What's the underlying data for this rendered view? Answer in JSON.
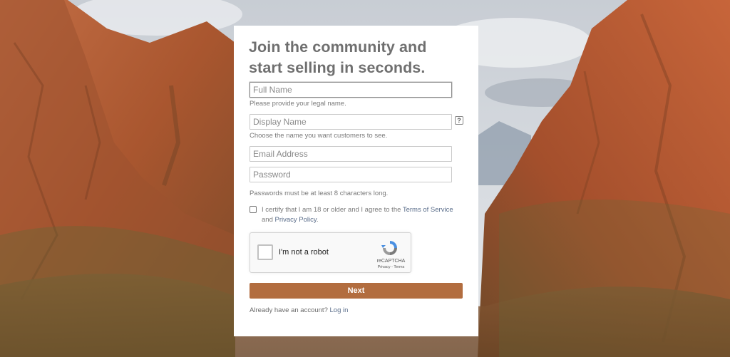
{
  "page": {
    "title": "Join the community and start selling in seconds."
  },
  "form": {
    "full_name": {
      "placeholder": "Full Name",
      "hint": "Please provide your legal name."
    },
    "display_name": {
      "placeholder": "Display Name",
      "hint": "Choose the name you want customers to see.",
      "help": "?"
    },
    "email": {
      "placeholder": "Email Address"
    },
    "password": {
      "placeholder": "Password",
      "hint": "Passwords must be at least 8 characters long."
    },
    "terms": {
      "prefix": "I certify that I am 18 or older and I agree to the ",
      "tos_link": "Terms of Service",
      "and": " and ",
      "privacy_link": "Privacy Policy",
      "suffix": ".",
      "checked": false
    },
    "captcha": {
      "label": "I'm not a robot",
      "brand": "reCAPTCHA",
      "privacy": "Privacy",
      "separator": " - ",
      "terms": "Terms"
    },
    "next_label": "Next",
    "login": {
      "prompt": "Already have an account? ",
      "link": "Log in"
    }
  },
  "colors": {
    "accent": "#b26d3f",
    "title": "#6f6f6f",
    "link": "#5a6d8a",
    "rock": "#b8603a",
    "sky": "#d8dde3"
  },
  "icons": {
    "captcha_logo": "recaptcha-icon",
    "help": "question-icon"
  }
}
